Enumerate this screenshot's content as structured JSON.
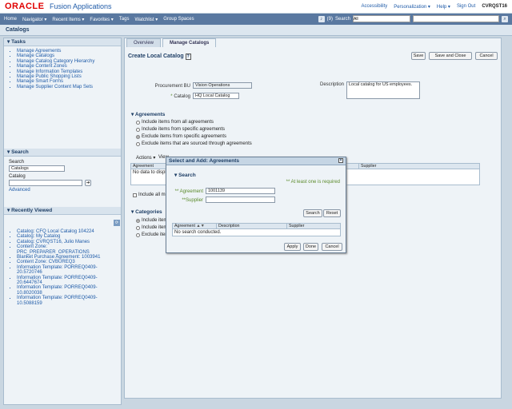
{
  "header": {
    "logo": "ORACLE",
    "app_title": "Fusion Applications",
    "links": [
      "Accessibility",
      "Personalization ▾",
      "Help ▾",
      "Sign Out"
    ],
    "user": "CVRQST16"
  },
  "nav": {
    "items": [
      "Home",
      "Navigator ▾",
      "Recent Items ▾",
      "Favorites ▾",
      "Tags",
      "Watchlist ▾",
      "Group Spaces"
    ],
    "watch_count": "(9)",
    "search_label": "Search",
    "search_scope": "All"
  },
  "page": {
    "title": "Catalogs"
  },
  "tasks": {
    "title": "Tasks",
    "items": [
      "Manage Agreements",
      "Manage Catalogs",
      "Manage Catalog Category Hierarchy",
      "Manage Content Zones",
      "Manage Information Templates",
      "Manage Public Shopping Lists",
      "Manage Smart Forms",
      "Manage Supplier Content Map Sets"
    ]
  },
  "leftsearch": {
    "title": "Search",
    "search_label": "Search",
    "search_value": "Catalogs",
    "catalog_label": "Catalog",
    "advanced": "Advanced"
  },
  "recent": {
    "title": "Recently Viewed",
    "items": [
      "Catalog: CFQ Local Catalog 104224",
      "Catalog: My Catalog",
      "Catalog: CVRQST16, Julio Manes",
      "Content Zone: PRC_PREPARER_OPERATIONS",
      "Blanket Purchase Agreement: 1003941",
      "Content Zone: CVBUREQ3",
      "Information Template: PORREQ0409-20.5720746",
      "Information Template: PORREQ0409-20.6447674",
      "Information Template: PORREQ0409-10.8020038",
      "Information Template: PORREQ0409-10.5088159"
    ]
  },
  "tabs": [
    "Overview",
    "Manage Catalogs"
  ],
  "form": {
    "title": "Create Local Catalog",
    "save": "Save",
    "save_close": "Save and Close",
    "cancel": "Cancel",
    "bu_label": "Procurement BU",
    "bu_value": "Vision Operations",
    "catalog_label": "Catalog",
    "catalog_value": "HQ Local Catalog",
    "desc_label": "Description",
    "desc_value": "Local catalog for US employees."
  },
  "agreements": {
    "title": "Agreements",
    "options": [
      "Include items from all agreements",
      "Include items from specific agreements",
      "Exclude items from specific agreements",
      "Exclude items that are sourced through agreements"
    ],
    "selected": 2,
    "actions": "Actions ▾",
    "view": "View",
    "col_agreement": "Agreement",
    "col_supplier": "Supplier",
    "nodata": "No data to display.",
    "include_all": "Include all m"
  },
  "categories": {
    "title": "Categories",
    "options": [
      "Include item",
      "Include item",
      "Exclude item"
    ]
  },
  "dialog": {
    "title": "Select and Add: Agreements",
    "search_title": "Search",
    "atleast": "** At least one is required",
    "agreement_label": "** Agreement",
    "agreement_value": "1001139",
    "supplier_label": "**Supplier",
    "search_btn": "Search",
    "reset_btn": "Reset",
    "cols": [
      "Agreement",
      "Description",
      "Supplier"
    ],
    "empty": "No search conducted.",
    "apply": "Apply",
    "done": "Done",
    "cancel": "Cancel"
  }
}
